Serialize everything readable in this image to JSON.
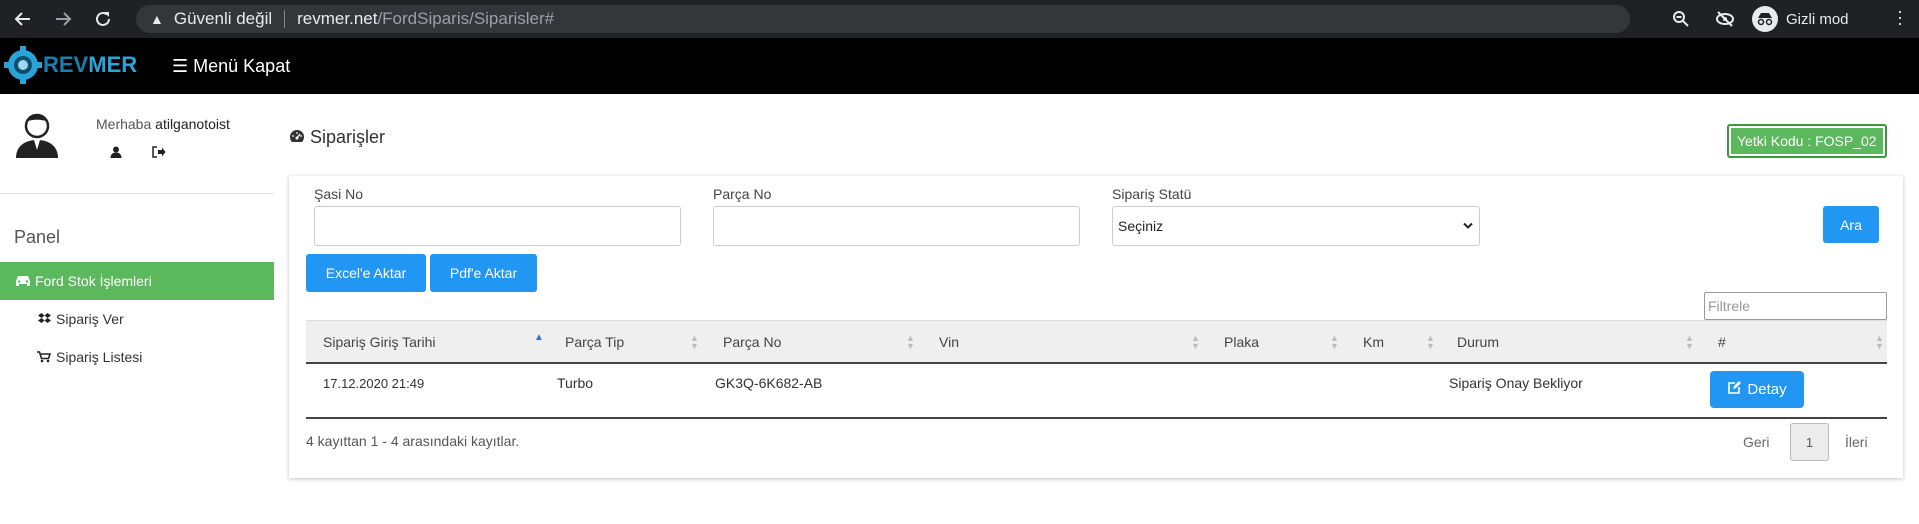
{
  "browser": {
    "security_label": "Güvenli değil",
    "url_host": "revmer.net",
    "url_path": "/FordSiparis/Siparisler#",
    "incognito_label": "Gizli mod"
  },
  "navbar": {
    "logo_text_a": "REV",
    "logo_text_b": "MER",
    "menu_toggle_label": "☰ Menü Kapat"
  },
  "sidebar": {
    "greeting": "Merhaba",
    "username": "atilganotoist",
    "panel_title": "Panel",
    "items": [
      {
        "label": "Ford Stok İşlemleri",
        "icon": "car-icon",
        "active": true
      },
      {
        "label": "Sipariş Ver",
        "icon": "dropbox-icon"
      },
      {
        "label": "Sipariş Listesi",
        "icon": "cart-icon"
      }
    ]
  },
  "main": {
    "page_title": "Siparişler",
    "auth_code": "Yetki Kodu : FOSP_02",
    "filters": {
      "sasi_label": "Şasi No",
      "sasi_value": "",
      "parca_label": "Parça No",
      "parca_value": "",
      "statu_label": "Sipariş Statü",
      "statu_selected": "Seçiniz"
    },
    "buttons": {
      "search": "Ara",
      "excel": "Excel'e Aktar",
      "pdf": "Pdf'e Aktar"
    },
    "table_filter_placeholder": "Filtrele",
    "columns": [
      "Sipariş Giriş Tarihi",
      "Parça Tip",
      "Parça No",
      "Vin",
      "Plaka",
      "Km",
      "Durum",
      "#"
    ],
    "rows": [
      {
        "date": "17.12.2020 21:49",
        "type": "Turbo",
        "part_no": "GK3Q-6K682-AB",
        "vin": "",
        "plate": "",
        "km": "",
        "status": "Sipariş Onay Bekliyor",
        "action": "Detay"
      }
    ],
    "info_text": "4 kayıttan 1 - 4 arasındaki kayıtlar.",
    "pagination": {
      "prev": "Geri",
      "current": "1",
      "next": "İleri"
    }
  }
}
